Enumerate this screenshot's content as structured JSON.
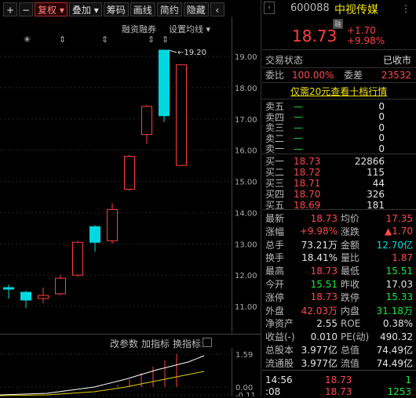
{
  "toolbar": {
    "plus": "+",
    "minus": "−",
    "fuquan": "复权",
    "diejia": "叠加",
    "chouma": "筹码",
    "huaxian": "画线",
    "jianyue": "简约",
    "yincang": "隐藏"
  },
  "sub_toolbar": {
    "rongzi": "融资融券",
    "settings": "设置均线"
  },
  "chart_data": {
    "type": "candlestick",
    "y_ticks": [
      "19.00",
      "18.00",
      "17.00",
      "16.00",
      "15.00",
      "14.00",
      "13.00",
      "12.00",
      "11.00"
    ],
    "max_label": "19.20",
    "candles": [
      {
        "o": 11.6,
        "c": 11.55,
        "h": 11.7,
        "l": 11.25,
        "dir": "down"
      },
      {
        "o": 11.45,
        "c": 11.2,
        "h": 11.5,
        "l": 10.95,
        "dir": "down"
      },
      {
        "o": 11.25,
        "c": 11.35,
        "h": 11.6,
        "l": 11.1,
        "dir": "up"
      },
      {
        "o": 11.4,
        "c": 11.9,
        "h": 12.0,
        "l": 11.35,
        "dir": "up"
      },
      {
        "o": 12.0,
        "c": 13.05,
        "h": 13.1,
        "l": 11.95,
        "dir": "up"
      },
      {
        "o": 13.55,
        "c": 13.05,
        "h": 13.6,
        "l": 12.75,
        "dir": "down"
      },
      {
        "o": 13.1,
        "c": 14.1,
        "h": 14.3,
        "l": 13.0,
        "dir": "up"
      },
      {
        "o": 14.75,
        "c": 15.8,
        "h": 15.85,
        "l": 14.7,
        "dir": "up"
      },
      {
        "o": 16.5,
        "c": 17.4,
        "h": 17.45,
        "l": 16.2,
        "dir": "up"
      },
      {
        "o": 19.2,
        "c": 17.1,
        "h": 19.2,
        "l": 16.9,
        "dir": "down"
      },
      {
        "o": 15.51,
        "c": 18.73,
        "h": 18.73,
        "l": 15.51,
        "dir": "up"
      }
    ],
    "indicator": {
      "ticks": [
        "1.59",
        "0.00",
        "-0.11"
      ]
    }
  },
  "indicator_toolbar": {
    "param": "改参数",
    "add": "加指标",
    "swap": "换指标"
  },
  "header": {
    "code": "600088",
    "name": "中视传媒",
    "badge": "融",
    "price": "18.73",
    "change": "+1.70",
    "pct": "+9.98%"
  },
  "status": {
    "label": "交易状态",
    "value": "已收市"
  },
  "ratio": {
    "weibi_label": "委比",
    "weibi": "100.00%",
    "weicha_label": "委差",
    "weicha": "23532"
  },
  "promo": "仅需20元查看十档行情",
  "sells": [
    {
      "label": "卖五",
      "price": "—",
      "vol": "0"
    },
    {
      "label": "卖四",
      "price": "—",
      "vol": "0"
    },
    {
      "label": "卖三",
      "price": "—",
      "vol": "0"
    },
    {
      "label": "卖二",
      "price": "—",
      "vol": "0"
    },
    {
      "label": "卖一",
      "price": "—",
      "vol": "0"
    }
  ],
  "buys": [
    {
      "label": "买一",
      "price": "18.73",
      "vol": "22866"
    },
    {
      "label": "买二",
      "price": "18.72",
      "vol": "115"
    },
    {
      "label": "买三",
      "price": "18.71",
      "vol": "44"
    },
    {
      "label": "买四",
      "price": "18.70",
      "vol": "326"
    },
    {
      "label": "买五",
      "price": "18.69",
      "vol": "181"
    }
  ],
  "stats": [
    {
      "l1": "最新",
      "v1": "18.73",
      "c1": "red",
      "l2": "均价",
      "v2": "17.35",
      "c2": "red"
    },
    {
      "l1": "涨幅",
      "v1": "+9.98%",
      "c1": "red",
      "l2": "涨跌",
      "v2": "▲1.70",
      "c2": "red"
    },
    {
      "l1": "总手",
      "v1": "73.21万",
      "c1": "white",
      "l2": "金额",
      "v2": "12.70亿",
      "c2": "cyan"
    },
    {
      "l1": "换手",
      "v1": "18.41%",
      "c1": "white",
      "l2": "量比",
      "v2": "1.87",
      "c2": "red"
    },
    {
      "l1": "最高",
      "v1": "18.73",
      "c1": "red",
      "l2": "最低",
      "v2": "15.51",
      "c2": "green"
    },
    {
      "l1": "今开",
      "v1": "15.51",
      "c1": "green",
      "l2": "昨收",
      "v2": "17.03",
      "c2": "white"
    },
    {
      "l1": "涨停",
      "v1": "18.73",
      "c1": "red",
      "l2": "跌停",
      "v2": "15.33",
      "c2": "green"
    },
    {
      "l1": "外盘",
      "v1": "42.03万",
      "c1": "red",
      "l2": "内盘",
      "v2": "31.18万",
      "c2": "green"
    },
    {
      "l1": "净资产",
      "v1": "2.55",
      "c1": "white",
      "l2": "ROE",
      "v2": "0.38%",
      "c2": "white"
    },
    {
      "l1": "收益(-)",
      "v1": "0.010",
      "c1": "white",
      "l2": "PE(动)",
      "v2": "490.32",
      "c2": "white"
    },
    {
      "l1": "总股本",
      "v1": "3.977亿",
      "c1": "white",
      "l2": "总值",
      "v2": "74.49亿",
      "c2": "white"
    },
    {
      "l1": "流通股",
      "v1": "3.977亿",
      "c1": "white",
      "l2": "流值",
      "v2": "74.49亿",
      "c2": "white"
    }
  ],
  "ticks": [
    {
      "time": "14:56",
      "price": "18.73",
      "vol": "1"
    },
    {
      "time": ":08",
      "price": "18.73",
      "vol": "1253"
    }
  ],
  "colors": {
    "up": "#ff4040",
    "down": "#00d8e0",
    "bg": "#000000"
  }
}
